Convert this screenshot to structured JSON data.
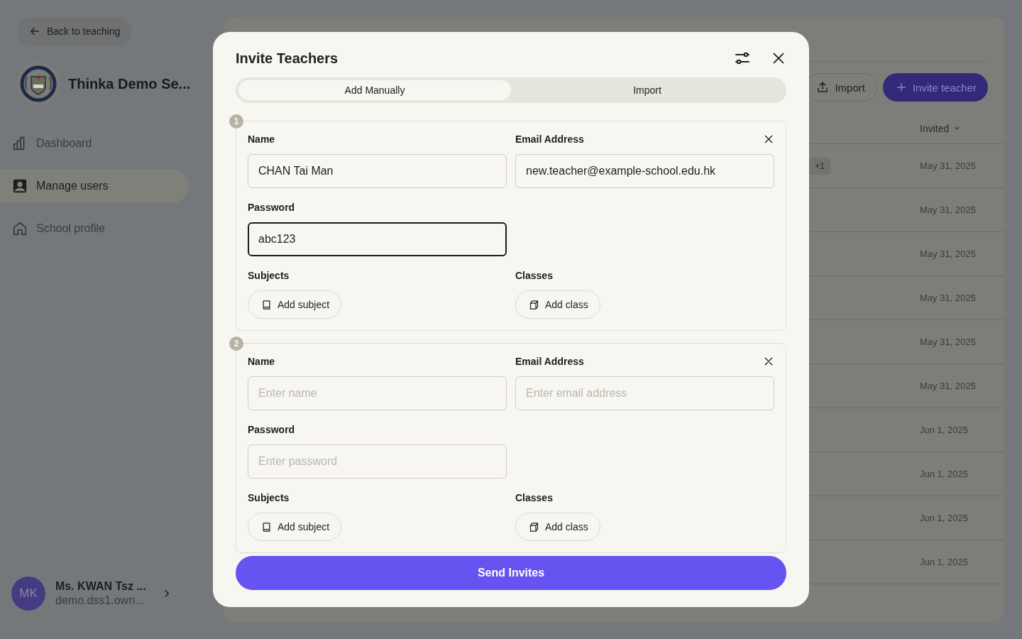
{
  "back_button": {
    "label": "Back to teaching"
  },
  "school": {
    "name": "Thinka Demo Se..."
  },
  "nav": [
    {
      "label": "Dashboard",
      "selected": false
    },
    {
      "label": "Manage users",
      "selected": true
    },
    {
      "label": "School profile",
      "selected": false
    }
  ],
  "user": {
    "initials": "MK",
    "name": "Ms. KWAN Tsz ...",
    "email": "demo.dss1.own..."
  },
  "toolbar": [
    {
      "label": "Import",
      "kind": "secondary"
    },
    {
      "label": "Invite teacher",
      "kind": "primary"
    }
  ],
  "table": {
    "columns": [
      {
        "label": "Invited"
      }
    ],
    "rows": [
      {
        "tag": "+1",
        "invited": "May 31, 2025"
      },
      {
        "invited": "May 31, 2025"
      },
      {
        "invited": "May 31, 2025"
      },
      {
        "invited": "May 31, 2025"
      },
      {
        "invited": "May 31, 2025"
      },
      {
        "invited": "May 31, 2025"
      },
      {
        "invited": "Jun 1, 2025"
      },
      {
        "invited": "Jun 1, 2025"
      },
      {
        "invited": "Jun 1, 2025"
      },
      {
        "invited": "Jun 1, 2025"
      }
    ]
  },
  "dialog": {
    "title": "Invite Teachers",
    "tabs": [
      {
        "label": "Add Manually",
        "selected": true
      },
      {
        "label": "Import",
        "selected": false
      }
    ],
    "teachers": [
      {
        "number": "1",
        "fields": [
          {
            "label": "Name",
            "value": "CHAN Tai Man",
            "focused": false
          },
          {
            "label": "Email Address",
            "value": "new.teacher@example-school.edu.hk",
            "focused": false
          },
          {
            "label": "Password",
            "value": "abc123",
            "focused": true
          }
        ],
        "subjects": {
          "label": "Subjects",
          "button": "Add subject"
        },
        "classes": {
          "label": "Classes",
          "button": "Add class"
        }
      },
      {
        "number": "2",
        "fields": [
          {
            "label": "Name",
            "placeholder": "Enter name",
            "focused": false
          },
          {
            "label": "Email Address",
            "placeholder": "Enter email address",
            "focused": false
          },
          {
            "label": "Password",
            "placeholder": "Enter password",
            "focused": false
          }
        ],
        "subjects": {
          "label": "Subjects",
          "button": "Add subject"
        },
        "classes": {
          "label": "Classes",
          "button": "Add class"
        }
      }
    ],
    "submit": "Send Invites"
  }
}
